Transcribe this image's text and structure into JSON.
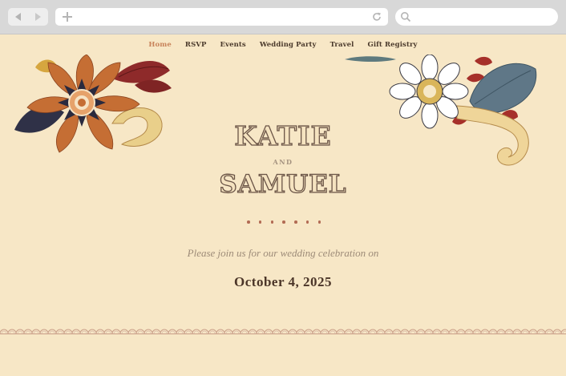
{
  "browser": {
    "back_icon": "back-arrow-icon",
    "forward_icon": "forward-arrow-icon",
    "new_tab_icon": "plus-icon",
    "reload_icon": "reload-icon",
    "search_icon": "search-icon"
  },
  "site_nav": {
    "items": [
      {
        "label": "Home",
        "active": true
      },
      {
        "label": "RSVP",
        "active": false
      },
      {
        "label": "Events",
        "active": false
      },
      {
        "label": "Wedding Party",
        "active": false
      },
      {
        "label": "Travel",
        "active": false
      },
      {
        "label": "Gift Registry",
        "active": false
      }
    ]
  },
  "hero": {
    "name_one": "KATIE",
    "conjunction": "AND",
    "name_two": "SAMUEL",
    "invite_text": "Please join us for our wedding celebration on",
    "date": "October 4, 2025"
  },
  "colors": {
    "background": "#f7e7c6",
    "nav_text": "#4b3a2c",
    "nav_active": "#c8835a",
    "accent_dots": "#b26b54",
    "date_text": "#4b3528"
  }
}
